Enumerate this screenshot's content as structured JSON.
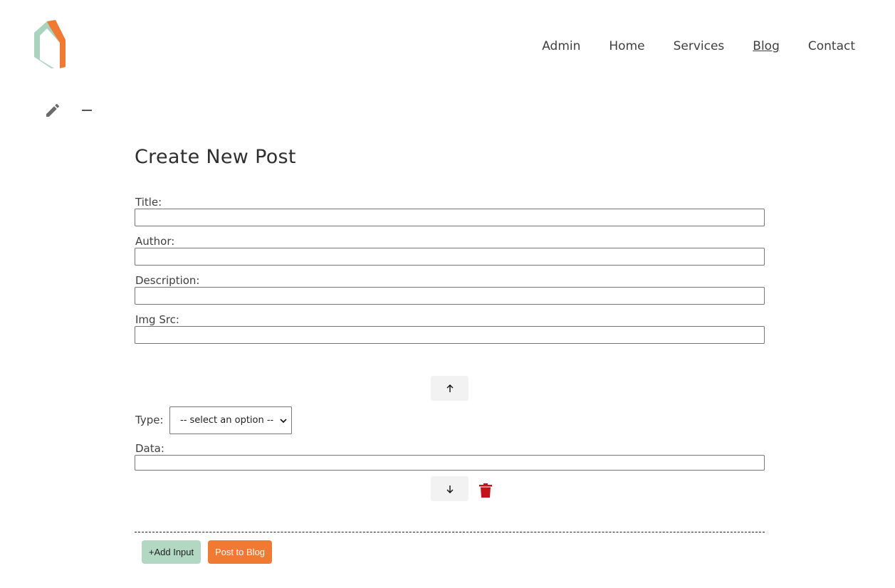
{
  "brand": {
    "logo_icon": "house-logo-icon",
    "colors": {
      "green": "#a9d3bd",
      "orange": "#f07a32"
    }
  },
  "nav": {
    "items": [
      {
        "label": "Admin"
      },
      {
        "label": "Home"
      },
      {
        "label": "Services"
      },
      {
        "label": "Blog",
        "active": true
      },
      {
        "label": "Contact"
      }
    ]
  },
  "toolbar": {
    "edit_icon": "pencil-icon",
    "collapse_icon": "minus-icon"
  },
  "form": {
    "title": "Create New Post",
    "fields": [
      {
        "label": "Title:",
        "value": ""
      },
      {
        "label": "Author:",
        "value": ""
      },
      {
        "label": "Description:",
        "value": ""
      },
      {
        "label": "Img Src:",
        "value": ""
      }
    ],
    "block": {
      "move_up_icon": "arrow-up-icon",
      "move_down_icon": "arrow-down-icon",
      "delete_icon": "trash-icon",
      "type_label": "Type:",
      "type_selected": "-- select an option --",
      "data_label": "Data:",
      "data_value": ""
    },
    "add_input_label": "+Add Input",
    "post_label": "Post to Blog"
  },
  "colors": {
    "add_button": "#b2d8c3",
    "post_button": "#f07a32",
    "delete": "#c0141a"
  }
}
